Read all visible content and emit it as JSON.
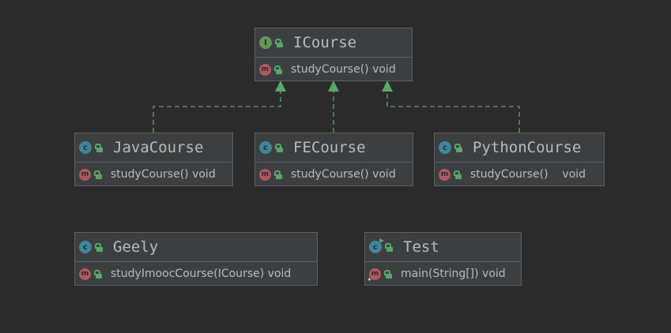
{
  "diagram": {
    "nodes": [
      {
        "id": "icourse",
        "kind": "interface",
        "kind_glyph": "I",
        "name": "ICourse",
        "members": [
          {
            "kind_glyph": "m",
            "text": "studyCourse() void"
          }
        ]
      },
      {
        "id": "javacourse",
        "kind": "class",
        "kind_glyph": "c",
        "name": "JavaCourse",
        "members": [
          {
            "kind_glyph": "m",
            "text": "studyCourse() void"
          }
        ]
      },
      {
        "id": "fecourse",
        "kind": "class",
        "kind_glyph": "c",
        "name": "FECourse",
        "members": [
          {
            "kind_glyph": "m",
            "text": "studyCourse() void"
          }
        ]
      },
      {
        "id": "pythoncourse",
        "kind": "class",
        "kind_glyph": "c",
        "name": "PythonCourse",
        "members": [
          {
            "kind_glyph": "m",
            "text": "studyCourse()    void"
          }
        ]
      },
      {
        "id": "geely",
        "kind": "class",
        "kind_glyph": "c",
        "name": "Geely",
        "members": [
          {
            "kind_glyph": "m",
            "text": "studyImoocCourse(ICourse) void"
          }
        ]
      },
      {
        "id": "test",
        "kind": "class-with-main",
        "kind_glyph": "c",
        "name": "Test",
        "members": [
          {
            "kind_glyph": "m",
            "text": "main(String[]) void"
          }
        ]
      }
    ],
    "edges": [
      {
        "from": "javacourse",
        "to": "icourse",
        "type": "realization"
      },
      {
        "from": "fecourse",
        "to": "icourse",
        "type": "realization"
      },
      {
        "from": "pythoncourse",
        "to": "icourse",
        "type": "realization"
      }
    ],
    "colors": {
      "background": "#2b2b2b",
      "node_fill": "#3c3f41",
      "node_border": "#5e6163",
      "text": "#bbbbbb",
      "realization_edge": "#59a869",
      "class_icon": "#3e86a0",
      "interface_icon": "#629755",
      "method_icon": "#b15860",
      "public_icon": "#59a869"
    }
  }
}
